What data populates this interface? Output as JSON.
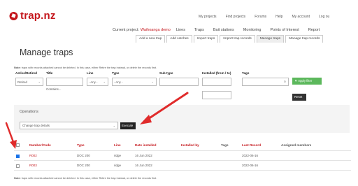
{
  "brand": {
    "name": "trap.nz",
    "color": "#c4161c"
  },
  "top_nav": [
    "My projects",
    "Find projects",
    "Forums",
    "Help",
    "My account",
    "Log ou"
  ],
  "project": {
    "prefix": "Current project:",
    "name": "Waihoanga demo",
    "nav": [
      "Lines",
      "Traps",
      "Bait stations",
      "Monitoring",
      "Points of Interest",
      "Report"
    ]
  },
  "tabs": [
    {
      "label": "Add a new trap",
      "active": false
    },
    {
      "label": "Add catches",
      "active": false
    },
    {
      "label": "Import traps",
      "active": false
    },
    {
      "label": "Import trap records",
      "active": false
    },
    {
      "label": "Manage traps",
      "active": true
    },
    {
      "label": "Manage trap records",
      "active": false
    }
  ],
  "page_title": "Manage traps",
  "note": {
    "prefix": "Note:",
    "text": "traps with records attached cannot be deleted. In this case, either Retire the trap instead, or delete the records first."
  },
  "filters": {
    "labels": {
      "status": "Active/Retired",
      "title": "Title",
      "line": "Line",
      "type": "Type",
      "subtype": "Sub type",
      "installed": "Installed (from / to)",
      "tags": "Tags"
    },
    "status_value": "Retired",
    "title_operator": "Contains...",
    "line_value": "- Any -",
    "type_value": "- Any -",
    "apply_label": "Apply filter",
    "reset_label": "Reset"
  },
  "operations": {
    "label": "Operations",
    "selected": "Change trap details",
    "execute_label": "Execute"
  },
  "table": {
    "headers": [
      "Number/Code",
      "Type",
      "Line",
      "Date installed",
      "Installed by",
      "Tags",
      "Last Record",
      "Assigned members"
    ],
    "rows": [
      {
        "checked": true,
        "code": "R002",
        "type": "DOC 200",
        "line": "ridge",
        "date": "16 Jun 2022",
        "installed_by": "",
        "tags": "",
        "last_record": "2022-06-16",
        "members": ""
      },
      {
        "checked": false,
        "code": "R003",
        "type": "DOC 200",
        "line": "ridge",
        "date": "16 Jun 2022",
        "installed_by": "",
        "tags": "",
        "last_record": "2022-06-16",
        "members": ""
      }
    ]
  },
  "colors": {
    "accent": "#c4161c",
    "apply": "#5cb85c",
    "arrow": "#e02b2b"
  }
}
